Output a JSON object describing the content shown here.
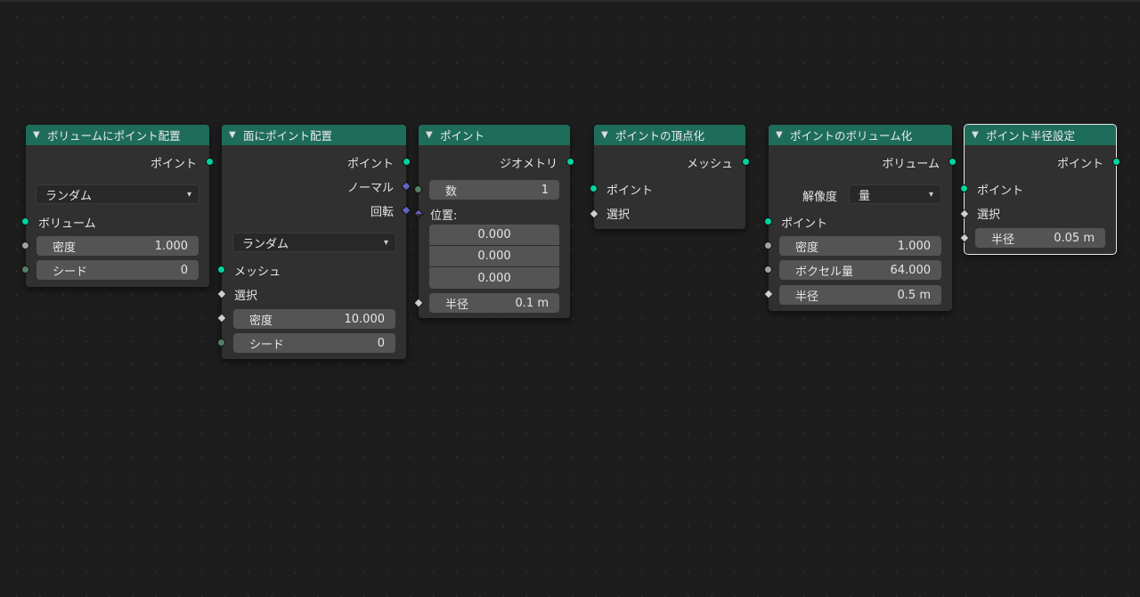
{
  "nodes": {
    "volume_points": {
      "title": "ボリュームにポイント配置",
      "out_points": "ポイント",
      "mode": "ランダム",
      "in_volume": "ボリューム",
      "density_label": "密度",
      "density_value": "1.000",
      "seed_label": "シード",
      "seed_value": "0"
    },
    "face_points": {
      "title": "面にポイント配置",
      "out_points": "ポイント",
      "out_normal": "ノーマル",
      "out_rotation": "回転",
      "mode": "ランダム",
      "in_mesh": "メッシュ",
      "in_selection": "選択",
      "density_label": "密度",
      "density_value": "10.000",
      "seed_label": "シード",
      "seed_value": "0"
    },
    "points": {
      "title": "ポイント",
      "out_geometry": "ジオメトリ",
      "count_label": "数",
      "count_value": "1",
      "position_label": "位置:",
      "position_values": [
        "0.000",
        "0.000",
        "0.000"
      ],
      "radius_label": "半径",
      "radius_value": "0.1 m"
    },
    "points_to_vertices": {
      "title": "ポイントの頂点化",
      "out_mesh": "メッシュ",
      "in_points": "ポイント",
      "in_selection": "選択"
    },
    "points_to_volume": {
      "title": "ポイントのボリューム化",
      "out_volume": "ボリューム",
      "resolution_label": "解像度",
      "resolution_value": "量",
      "in_points": "ポイント",
      "density_label": "密度",
      "density_value": "1.000",
      "voxel_label": "ボクセル量",
      "voxel_value": "64.000",
      "radius_label": "半径",
      "radius_value": "0.5 m"
    },
    "set_point_radius": {
      "title": "ポイント半径設定",
      "out_points": "ポイント",
      "in_points": "ポイント",
      "in_selection": "選択",
      "radius_label": "半径",
      "radius_value": "0.05 m"
    }
  },
  "colors": {
    "header": "#1e6d5a",
    "geometry_socket": "#00d3a0",
    "float_socket": "#a1a1a1",
    "int_socket": "#548066",
    "vector_socket": "#6363c5",
    "canvas": "#1d1d1d",
    "node_body": "#303030",
    "field": "#545454"
  }
}
